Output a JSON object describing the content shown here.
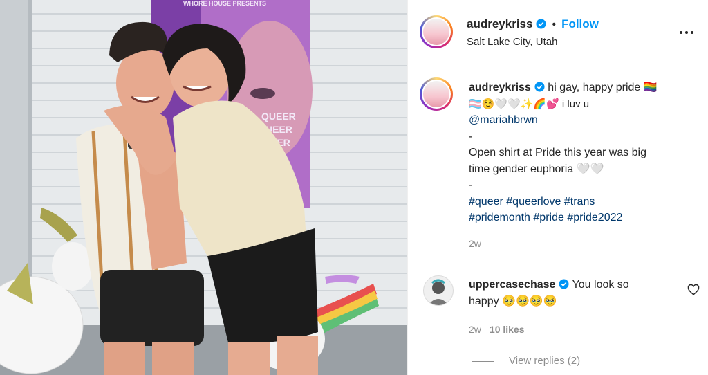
{
  "post": {
    "author": "audreykriss",
    "follow_label": "Follow",
    "separator": "•",
    "location": "Salt Lake City, Utah",
    "more_label": "More options",
    "poster_header": "WHORE HOUSE PRESENTS",
    "poster_lines": [
      "QUEER",
      "UEER",
      "EER"
    ]
  },
  "caption": {
    "author": "audreykriss",
    "line1": "hi gay, happy pride 🏳️‍🌈",
    "line2": "🏳️‍⚧️☺️🤍🤍✨🌈💕  i luv u",
    "mention": "@mariahbrwn",
    "dash1": "-",
    "text1": "Open shirt at Pride this year was big",
    "text2": "time gender euphoria 🤍🤍",
    "dash2": "-",
    "tags1": "#queer #queerlove #trans",
    "tags2": "#pridemonth #pride #pride2022",
    "time": "2w"
  },
  "comment": {
    "author": "uppercasechase",
    "text1": "You look so",
    "text2": "happy 🥹🥹🥹🥹",
    "time": "2w",
    "likes": "10 likes",
    "replies": "View replies (2)"
  },
  "colors": {
    "link": "#0095f6",
    "hashtag": "#00376b",
    "muted": "#8e8e8e",
    "verified": "#0095f6"
  }
}
